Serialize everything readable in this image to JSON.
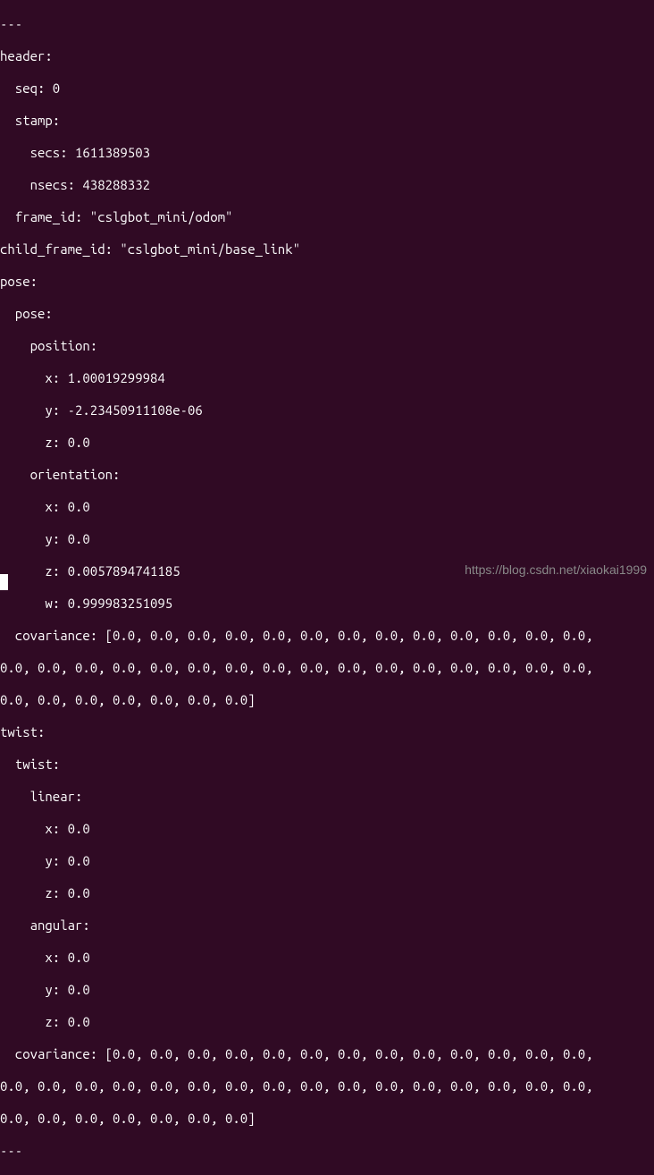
{
  "lines": {
    "l0": "---",
    "l1": "header:",
    "l2": "  seq: 0",
    "l3": "  stamp:",
    "l4": "    secs: 1611389503",
    "l5": "    nsecs: 438288332",
    "l6": "  frame_id: \"cslgbot_mini/odom\"",
    "l7": "child_frame_id: \"cslgbot_mini/base_link\"",
    "l8": "pose:",
    "l9": "  pose:",
    "l10": "    position:",
    "l11": "      x: 1.00019299984",
    "l12": "      y: -2.23450911108e-06",
    "l13": "      z: 0.0",
    "l14": "    orientation:",
    "l15": "      x: 0.0",
    "l16": "      y: 0.0",
    "l17": "      z: 0.0057894741185",
    "l18": "      w: 0.999983251095",
    "l19": "  covariance: [0.0, 0.0, 0.0, 0.0, 0.0, 0.0, 0.0, 0.0, 0.0, 0.0, 0.0, 0.0, 0.0,",
    "l20": "0.0, 0.0, 0.0, 0.0, 0.0, 0.0, 0.0, 0.0, 0.0, 0.0, 0.0, 0.0, 0.0, 0.0, 0.0, 0.0,",
    "l21": "0.0, 0.0, 0.0, 0.0, 0.0, 0.0, 0.0]",
    "l22": "twist:",
    "l23": "  twist:",
    "l24": "    linear:",
    "l25": "      x: 0.0",
    "l26": "      y: 0.0",
    "l27": "      z: 0.0",
    "l28": "    angular:",
    "l29": "      x: 0.0",
    "l30": "      y: 0.0",
    "l31": "      z: 0.0",
    "l32": "  covariance: [0.0, 0.0, 0.0, 0.0, 0.0, 0.0, 0.0, 0.0, 0.0, 0.0, 0.0, 0.0, 0.0,",
    "l33": "0.0, 0.0, 0.0, 0.0, 0.0, 0.0, 0.0, 0.0, 0.0, 0.0, 0.0, 0.0, 0.0, 0.0, 0.0, 0.0,",
    "l34": "0.0, 0.0, 0.0, 0.0, 0.0, 0.0, 0.0]",
    "l35": "---"
  },
  "watermark": "https://blog.csdn.net/xiaokai1999"
}
